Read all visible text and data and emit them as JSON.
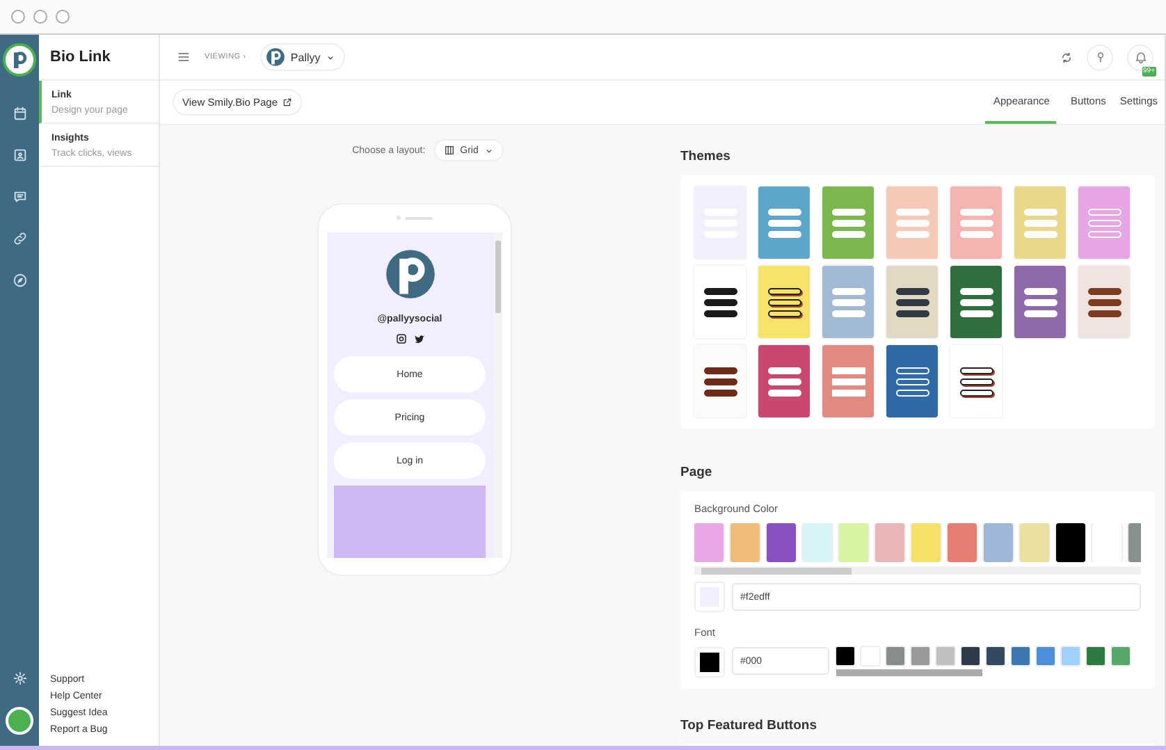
{
  "sidebar": {
    "title": "Bio Link",
    "items": [
      {
        "label": "Link",
        "description": "Design your page",
        "selected": true
      },
      {
        "label": "Insights",
        "description": "Track clicks, views",
        "selected": false
      }
    ],
    "footer_links": [
      "Support",
      "Help Center",
      "Suggest Idea",
      "Report a Bug"
    ]
  },
  "top_bar": {
    "viewing": "VIEWING ›",
    "account": "Pallyy",
    "notification_badge": "99+"
  },
  "toolbar": {
    "view_button": "View Smily.Bio Page",
    "tabs": [
      {
        "label": "Appearance",
        "selected": true
      },
      {
        "label": "Buttons",
        "selected": false
      },
      {
        "label": "Settings",
        "selected": false
      }
    ]
  },
  "preview": {
    "layout_label": "Choose a layout:",
    "layout_value": "Grid",
    "handle": "@pallyysocial",
    "links": [
      "Home",
      "Pricing",
      "Log in"
    ]
  },
  "themes": {
    "title": "Themes",
    "items": [
      {
        "color": "#f3eefc",
        "button": {
          "color": "#ffffff"
        },
        "kind": "filled"
      },
      {
        "color": "#5ba6c9",
        "button": {
          "color": "#ffffff"
        },
        "kind": "filled"
      },
      {
        "color": "#7ab84e",
        "button": {
          "color": "#ffffff"
        },
        "kind": "filled"
      },
      {
        "color": "#f5c9b5",
        "button": {
          "color": "#ffffff"
        },
        "kind": "filled"
      },
      {
        "color": "#f4b4b0",
        "button": {
          "color": "#ffffff"
        },
        "kind": "filled"
      },
      {
        "color": "#e8d98a",
        "button": {
          "color": "#ffffff"
        },
        "kind": "filled"
      },
      {
        "color": "#e6a6e6",
        "button": {
          "color": "#ffffff"
        },
        "kind": "outline"
      },
      {
        "color": "#ffffff",
        "button": {
          "color": "#1a1a1a"
        },
        "kind": "filled"
      },
      {
        "color": "#f7e36a",
        "button": {
          "color": "#f7e36a"
        },
        "kind": "shadow"
      },
      {
        "color": "#a3bad6",
        "button": {
          "color": "#ffffff"
        },
        "kind": "filled"
      },
      {
        "color": "#e3d8c4",
        "button": {
          "color": "#2f3a45"
        },
        "kind": "filled"
      },
      {
        "color": "#2f6e3e",
        "button": {
          "color": "#ffffff"
        },
        "kind": "filled"
      },
      {
        "color": "#8f6aa8",
        "button": {
          "color": "#ffffff"
        },
        "kind": "filled"
      },
      {
        "color": "#f1e4e0",
        "button": {
          "color": "#7a3e1f"
        },
        "kind": "filled"
      },
      {
        "color": "#fdfbf9",
        "button": {
          "color": "#6b2a1a"
        },
        "kind": "filled"
      },
      {
        "color": "#c94870",
        "button": {
          "color": "#ffffff"
        },
        "kind": "filled"
      },
      {
        "color": "#e08a80",
        "button": {
          "color": "#ffffff"
        },
        "kind": "square"
      },
      {
        "color": "#2e6aa8",
        "button": {
          "color": "#ffffff"
        },
        "kind": "outline"
      },
      {
        "color": "#ffffff",
        "button": {
          "color": "#ffffff"
        },
        "kind": "shadow"
      }
    ]
  },
  "page": {
    "title": "Page",
    "background": {
      "label": "Background Color",
      "value": "#f2edff",
      "swatches": [
        {
          "color": "#e8a6e6"
        },
        {
          "color": "#f0bc7a"
        },
        {
          "color": "#8a4fc0"
        },
        {
          "color": "#d8f4f6"
        },
        {
          "color": "#d6f5a0"
        },
        {
          "color": "#eab6b8"
        },
        {
          "color": "#f6e06a"
        },
        {
          "color": "#e77c70"
        },
        {
          "color": "#9fb6d8"
        },
        {
          "color": "#e9e0a0"
        },
        {
          "color": "#000000"
        },
        {
          "color": "#ffffff"
        },
        {
          "color": "#878f8f"
        }
      ]
    },
    "font": {
      "label": "Font",
      "value": "#000",
      "swatches": [
        {
          "color": "#000000"
        },
        {
          "color": "#ffffff"
        },
        {
          "color": "#878c8c"
        },
        {
          "color": "#9a9a9a"
        },
        {
          "color": "#c0c0c0"
        },
        {
          "color": "#2d3a48"
        },
        {
          "color": "#34495e"
        },
        {
          "color": "#3d77b0"
        },
        {
          "color": "#4a90d9"
        },
        {
          "color": "#9fd0ff"
        },
        {
          "color": "#2f7a44"
        },
        {
          "color": "#55a868"
        }
      ]
    }
  },
  "next_section": {
    "title": "Top Featured Buttons"
  }
}
